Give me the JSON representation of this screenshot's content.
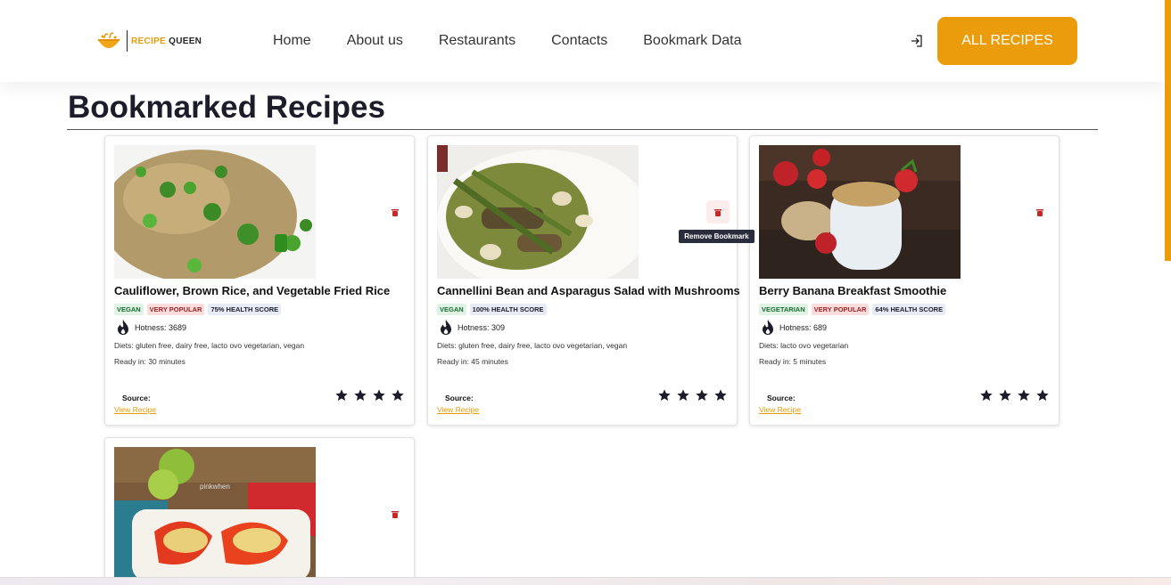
{
  "header": {
    "logo_text_accent": "RECIPE",
    "logo_text_main": "QUEEN",
    "nav": [
      "Home",
      "About us",
      "Restaurants",
      "Contacts",
      "Bookmark Data"
    ],
    "cta_label": "ALL RECIPES"
  },
  "page": {
    "title": "Bookmarked Recipes"
  },
  "tooltip": "Remove Bookmark",
  "cards": [
    {
      "title": "Cauliflower, Brown Rice, and Vegetable Fried Rice",
      "badges": [
        {
          "text": "Vegan",
          "style": "green"
        },
        {
          "text": "Very Popular",
          "style": "red"
        },
        {
          "text": "75% Health Score",
          "style": "blue"
        }
      ],
      "hotness": "Hotness: 3689",
      "diets": "Diets: gluten free, dairy free, lacto ovo vegetarian, vegan",
      "ready": "Ready in: 30 minutes",
      "source": "Source:",
      "link": "View Recipe",
      "rating": 4
    },
    {
      "title": "Cannellini Bean and Asparagus Salad with Mushrooms",
      "badges": [
        {
          "text": "Vegan",
          "style": "green"
        },
        {
          "text": "100% Health Score",
          "style": "blue"
        }
      ],
      "hotness": "Hotness: 309",
      "diets": "Diets: gluten free, dairy free, lacto ovo vegetarian, vegan",
      "ready": "Ready in: 45 minutes",
      "source": "Source:",
      "link": "View Recipe",
      "rating": 4
    },
    {
      "title": "Berry Banana Breakfast Smoothie",
      "badges": [
        {
          "text": "Vegetarian",
          "style": "green"
        },
        {
          "text": "Very Popular",
          "style": "red"
        },
        {
          "text": "64% Health Score",
          "style": "blue"
        }
      ],
      "hotness": "Hotness: 689",
      "diets": "Diets: lacto ovo vegetarian",
      "ready": "Ready in: 5 minutes",
      "source": "Source:",
      "link": "View Recipe",
      "rating": 4
    },
    {
      "image_watermark": "pinkwhen"
    }
  ],
  "colors": {
    "accent": "#eb9c0b",
    "title": "#1c1c2b",
    "danger": "#c62828"
  }
}
